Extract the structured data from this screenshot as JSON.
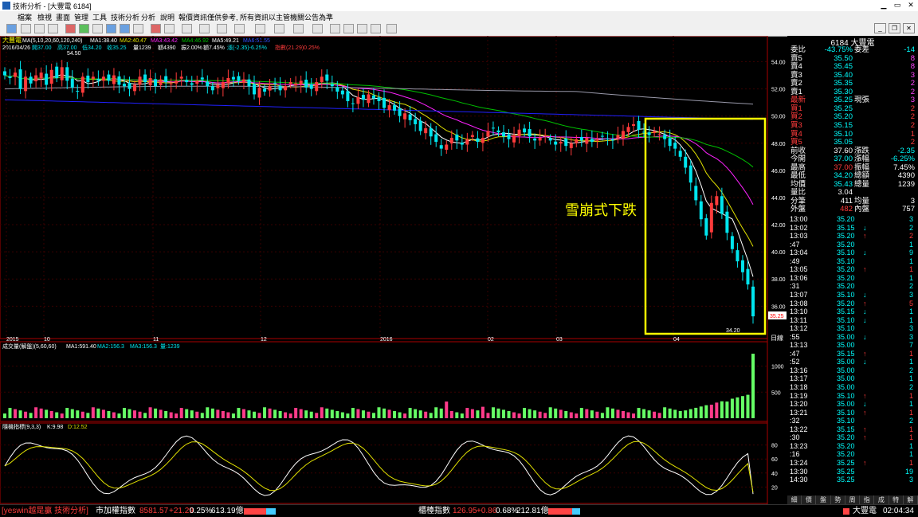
{
  "window": {
    "title": "技術分析 - [大豐電 6184]"
  },
  "menu": [
    "檔案",
    "檢視",
    "畫面",
    "管理",
    "工具",
    "技術分析",
    "分析",
    "說明",
    "報價資訊僅供參考, 所有資訊以主管機關公告為準"
  ],
  "price_panel": {
    "stock_label": "大豐電",
    "ma_label": "MA(5,10,20,60,120,240)",
    "ma_values": [
      "MA1:38.40",
      "MA2:40.47",
      "MA3:43.42",
      "MA4:46.92",
      "MA5:49.21",
      "MA6:51.55"
    ],
    "info_date": "2016/04/26",
    "info_ohlc": [
      "開37.00",
      "高37.00",
      "低34.20",
      "收35.25"
    ],
    "info_vol": "量1239",
    "info_amt": "額4390",
    "info_rest": [
      "振2.00%",
      "額7.45%"
    ],
    "info_change": "漲(-2.35)-6.25%",
    "info_indicator": "指數(21.29)0.25%",
    "high_marker": "54.50",
    "low_marker": "34.20",
    "current_tag": "35.25",
    "annotation": "雪崩式下跌",
    "y_ticks": [
      "54.00",
      "52.00",
      "50.00",
      "48.00",
      "46.00",
      "44.00",
      "42.00",
      "40.00",
      "38.00",
      "36.00"
    ],
    "x_labels": [
      "2015",
      "10",
      "11",
      "12",
      "2016",
      "02",
      "03",
      "04"
    ],
    "unit": "日線"
  },
  "volume_panel": {
    "label": "成交量(解盤)(5,60,60)",
    "values": [
      "MA1:591.40",
      "MA2:156.3",
      "MA3:156.3",
      "量:1239"
    ],
    "y_ticks": [
      "1000",
      "500"
    ]
  },
  "kd_panel": {
    "label": "隨機指標(9,3,3)",
    "k": "K:9.98",
    "d": "D:12.52",
    "y_ticks": [
      "80",
      "60",
      "40",
      "20"
    ]
  },
  "quote": {
    "header": "6184 大豐電",
    "row1": {
      "l1": "委比",
      "v1": "-43.75%",
      "l2": "委差",
      "v2": "-14"
    },
    "asks": [
      {
        "label": "賣5",
        "price": "35.50",
        "vol": "8"
      },
      {
        "label": "賣4",
        "price": "35.45",
        "vol": "8"
      },
      {
        "label": "賣3",
        "price": "35.40",
        "vol": "3"
      },
      {
        "label": "賣2",
        "price": "35.35",
        "vode": "",
        "vol": "2"
      },
      {
        "label": "賣1",
        "price": "35.30",
        "vol": "2"
      }
    ],
    "last": {
      "label": "最新",
      "price": "35.25",
      "l2": "現張",
      "vol": "3"
    },
    "bids": [
      {
        "label": "買1",
        "price": "35.25",
        "vol": "2"
      },
      {
        "label": "買2",
        "price": "35.20",
        "vol": "2"
      },
      {
        "label": "買3",
        "price": "35.15",
        "vol": "2"
      },
      {
        "label": "買4",
        "price": "35.10",
        "vol": "1"
      },
      {
        "label": "買5",
        "price": "35.05",
        "vol": "2"
      }
    ],
    "stats": [
      {
        "l1": "前收",
        "v1": "37.60",
        "l2": "漲跌",
        "v2": "-2.35"
      },
      {
        "l1": "今開",
        "v1": "37.00",
        "l2": "漲幅",
        "v2": "-6.25%"
      },
      {
        "l1": "最高",
        "v1": "37.00",
        "l2": "振幅",
        "v2": "7.45%"
      },
      {
        "l1": "最低",
        "v1": "34.20",
        "l2": "總額",
        "v2": "4390"
      },
      {
        "l1": "均價",
        "v1": "35.43",
        "l2": "總量",
        "v2": "1239"
      },
      {
        "l1": "量比",
        "v1": "3.04",
        "l2": "",
        "v2": ""
      },
      {
        "l1": "分筆",
        "v1": "411",
        "l2": "均量",
        "v2": "3"
      },
      {
        "l1": "外盤",
        "v1": "482",
        "l2": "內盤",
        "v2": "757"
      }
    ],
    "ticks": [
      {
        "t": "13:00",
        "p": "35.20",
        "a": "",
        "v": "3"
      },
      {
        "t": "13:02",
        "p": "35.15",
        "a": "↓",
        "v": "2"
      },
      {
        "t": "13:03",
        "p": "35.20",
        "a": "↑",
        "v": "2"
      },
      {
        "t": ":47",
        "p": "35.20",
        "a": "",
        "v": "1"
      },
      {
        "t": "13:04",
        "p": "35.10",
        "a": "↓",
        "v": "9"
      },
      {
        "t": ":49",
        "p": "35.10",
        "a": "",
        "v": "1"
      },
      {
        "t": "13:05",
        "p": "35.20",
        "a": "↑",
        "v": "1"
      },
      {
        "t": "13:06",
        "p": "35.20",
        "a": "",
        "v": "1"
      },
      {
        "t": ":31",
        "p": "35.20",
        "a": "",
        "v": "2"
      },
      {
        "t": "13:07",
        "p": "35.10",
        "a": "↓",
        "v": "3"
      },
      {
        "t": "13:08",
        "p": "35.20",
        "a": "↑",
        "v": "5"
      },
      {
        "t": "13:10",
        "p": "35.15",
        "a": "↓",
        "v": "1"
      },
      {
        "t": "13:11",
        "p": "35.10",
        "a": "↓",
        "v": "1"
      },
      {
        "t": "13:12",
        "p": "35.10",
        "a": "",
        "v": "3"
      },
      {
        "t": ":55",
        "p": "35.00",
        "a": "↓",
        "v": "3"
      },
      {
        "t": "13:13",
        "p": "35.00",
        "a": "",
        "v": "7"
      },
      {
        "t": ":47",
        "p": "35.15",
        "a": "↑",
        "v": "1"
      },
      {
        "t": ":52",
        "p": "35.00",
        "a": "↓",
        "v": "1"
      },
      {
        "t": "13:16",
        "p": "35.00",
        "a": "",
        "v": "2"
      },
      {
        "t": "13:17",
        "p": "35.00",
        "a": "",
        "v": "1"
      },
      {
        "t": "13:18",
        "p": "35.00",
        "a": "",
        "v": "2"
      },
      {
        "t": "13:19",
        "p": "35.10",
        "a": "↑",
        "v": "1"
      },
      {
        "t": "13:20",
        "p": "35.00",
        "a": "↓",
        "v": "1"
      },
      {
        "t": "13:21",
        "p": "35.10",
        "a": "↑",
        "v": "1"
      },
      {
        "t": ":32",
        "p": "35.10",
        "a": "",
        "v": "2"
      },
      {
        "t": "13:22",
        "p": "35.15",
        "a": "↑",
        "v": "1"
      },
      {
        "t": ":30",
        "p": "35.20",
        "a": "↑",
        "v": "1"
      },
      {
        "t": "13:23",
        "p": "35.20",
        "a": "",
        "v": "1"
      },
      {
        "t": ":16",
        "p": "35.20",
        "a": "",
        "v": "1"
      },
      {
        "t": "13:24",
        "p": "35.25",
        "a": "↑",
        "v": "1"
      },
      {
        "t": "13:30",
        "p": "35.25",
        "a": "",
        "v": "19"
      },
      {
        "t": "14:30",
        "p": "35.25",
        "a": "",
        "v": "3"
      }
    ],
    "tabs": [
      "細",
      "價",
      "盤",
      "勢",
      "周",
      "指",
      "成",
      "特",
      "解"
    ]
  },
  "status": {
    "brand": "[yeswin越是贏 技術分析]",
    "index1_name": "市加權指數",
    "index1_val": "8581.57",
    "index1_chg": "+21.29",
    "index1_pct": "0.25%",
    "index1_amt": "613.19億",
    "index2_name": "櫃檯指數",
    "index2_val": "126.95",
    "index2_chg": "+0.86",
    "index2_pct": "0.68%",
    "index2_amt": "212.81億",
    "stock": "大豐電",
    "time": "02:04:34"
  },
  "colors": {
    "up": "#ff3b3b",
    "down": "#00e5ee",
    "vol_up": "#ff3b8a",
    "vol_down": "#66ff66",
    "ma5": "#ffffff",
    "ma10": "#e0e000",
    "ma20": "#ff22ff",
    "ma60": "#00c000",
    "ma120": "#2020ff",
    "ma240": "#9999aa",
    "frame": "#ffff00"
  },
  "chart_data": {
    "type": "candlestick",
    "x": [
      "2015/09",
      "2015/10",
      "2015/11",
      "2015/12",
      "2016/01",
      "2016/02",
      "2016/03",
      "2016/04"
    ],
    "close": [
      53.0,
      52.8,
      53.2,
      52.0,
      52.9,
      52.4,
      53.0,
      53.2,
      52.3,
      53.4,
      52.8,
      53.6,
      52.6,
      52.1,
      51.8,
      52.9,
      52.5,
      52.9,
      52.6,
      52.9,
      52.6,
      53.0,
      52.3,
      52.2,
      52.0,
      52.3,
      52.9,
      52.5,
      52.8,
      52.2,
      52.7,
      52.5,
      52.4,
      52.6,
      52.9,
      52.5,
      52.3,
      52.6,
      52.7,
      52.2,
      51.9,
      52.3,
      52.5,
      52.8,
      52.7,
      52.6,
      52.7,
      52.2,
      51.6,
      52.1,
      51.8,
      52.2,
      52.4,
      51.9,
      52.2,
      52.5,
      52.4,
      52.6,
      52.1,
      52.0,
      52.5,
      52.9,
      52.6,
      52.2,
      51.8,
      51.6,
      51.1,
      50.9,
      51.4,
      51.2,
      51.6,
      51.3,
      51.1,
      50.6,
      50.8,
      50.4,
      50.0,
      50.2,
      49.7,
      49.4,
      48.9,
      49.1,
      48.5,
      48.1,
      47.6,
      47.9,
      48.4,
      48.2,
      47.9,
      48.3,
      48.6,
      48.1,
      48.4,
      48.9,
      49.1,
      48.8,
      48.5,
      48.3,
      48.6,
      49.0,
      48.8,
      48.5,
      48.2,
      48.4,
      48.6,
      48.2,
      47.9,
      48.1,
      47.8,
      48.0,
      48.3,
      48.2,
      48.4,
      48.1,
      48.3,
      48.5,
      48.3,
      48.2,
      48.6,
      48.9,
      49.2,
      49.4,
      49.0,
      48.8,
      48.6,
      48.9,
      48.7,
      48.3,
      47.8,
      47.6,
      47.0,
      46.2,
      45.1,
      43.8,
      42.4,
      41.2,
      43.6,
      44.1,
      42.8,
      41.4,
      40.2,
      39.3,
      38.5,
      37.6,
      35.25
    ],
    "ylim": [
      34.2,
      54.5
    ],
    "volume_ylim": [
      0,
      1300
    ],
    "kd_ylim": [
      0,
      100
    ],
    "last_volume": 1239,
    "k_last": 9.98,
    "d_last": 12.52
  }
}
